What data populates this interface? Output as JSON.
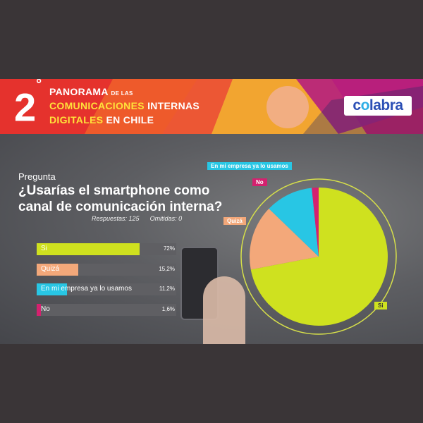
{
  "header": {
    "number": "2",
    "degree": "°",
    "line1_main": "PANORAMA",
    "line1_small": "DE LAS",
    "line2_a": "COMUNICACIONES",
    "line2_b": "INTERNAS",
    "line3_a": "DIGITALES",
    "line3_b": "EN CHILE",
    "logo_pre": "c",
    "logo_o": "o",
    "logo_post": "labra"
  },
  "question": {
    "kicker": "Pregunta",
    "line1": "¿Usarías el smartphone como",
    "line2": "canal de comunicación interna?",
    "responses": "Respuestas: 125",
    "omitted": "Omitidas: 0"
  },
  "colors": {
    "si": "#cfe11f",
    "quiza": "#f3a87a",
    "empresa": "#28c6e4",
    "no": "#d4216f"
  },
  "chart_data": {
    "type": "bar",
    "categories": [
      "Si",
      "Quizá",
      "En mi empresa ya lo usamos",
      "No"
    ],
    "values": [
      72,
      15.2,
      11.2,
      1.6
    ],
    "value_labels": [
      "72%",
      "15,2%",
      "11,2%",
      "1,6%"
    ],
    "unit": "%",
    "pie_labels": [
      "Si",
      "Quizá",
      "En mi empresa ya lo usamos",
      "No"
    ]
  }
}
